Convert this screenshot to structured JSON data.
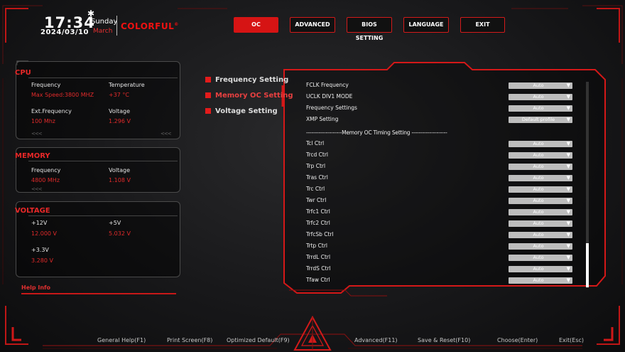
{
  "header": {
    "time": "17:34",
    "day": "Sunday",
    "date": "2024/03/10",
    "month": "March",
    "brand": "COLORFUL",
    "brand_mark": "®"
  },
  "tabs": [
    {
      "label": "OC",
      "active": true
    },
    {
      "label": "ADVANCED",
      "active": false
    },
    {
      "label": "BIOS SETTING",
      "active": false
    },
    {
      "label": "LANGUAGE",
      "active": false
    },
    {
      "label": "EXIT",
      "active": false
    }
  ],
  "cpu": {
    "title": "CPU",
    "frequency_label": "Frequency",
    "frequency_value": "Max Speed:3800 MHZ",
    "temperature_label": "Temperature",
    "temperature_value": "+37 °C",
    "ext_label": "Ext.Frequency",
    "ext_value": "100 Mhz",
    "voltage_label": "Voltage",
    "voltage_value": "1.296 V"
  },
  "memory": {
    "title": "MEMORY",
    "frequency_label": "Frequency",
    "frequency_value": "4800 MHz",
    "voltage_label": "Voltage",
    "voltage_value": "1.108 V"
  },
  "voltage": {
    "title": "VOLTAGE",
    "v12_label": "+12V",
    "v12_value": "12.000 V",
    "v5_label": "+5V",
    "v5_value": "5.032 V",
    "v33_label": "+3.3V",
    "v33_value": "3.280 V"
  },
  "chevrons": "<<<",
  "help_info": "Help Info",
  "submenu": [
    {
      "label": "Frequency Setting",
      "active": false
    },
    {
      "label": "Memory OC Setting",
      "active": true
    },
    {
      "label": "Voltage Setting",
      "active": false
    }
  ],
  "settings_top": [
    {
      "label": "FCLK Frequency",
      "value": "Auto"
    },
    {
      "label": "UCLK DIV1 MODE",
      "value": "Auto"
    },
    {
      "label": "Frequency Settings",
      "value": "Auto"
    },
    {
      "label": "XMP Setting",
      "value": "Default profile"
    }
  ],
  "timing_divider": "--------------------Memory OC Timing Setting --------------------",
  "settings_timing": [
    {
      "label": "Tcl Ctrl",
      "value": "Auto"
    },
    {
      "label": "Trcd Ctrl",
      "value": "Auto"
    },
    {
      "label": "Trp Ctrl",
      "value": "Auto"
    },
    {
      "label": "Tras Ctrl",
      "value": "Auto"
    },
    {
      "label": "Trc Ctrl",
      "value": "Auto"
    },
    {
      "label": "Twr Ctrl",
      "value": "Auto"
    },
    {
      "label": "Trfc1 Ctrl",
      "value": "Auto"
    },
    {
      "label": "Trfc2 Ctrl",
      "value": "Auto"
    },
    {
      "label": "TrfcSb Ctrl",
      "value": "Auto"
    },
    {
      "label": "Trtp Ctrl",
      "value": "Auto"
    },
    {
      "label": "TrrdL Ctrl",
      "value": "Auto"
    },
    {
      "label": "TrrdS Ctrl",
      "value": "Auto"
    },
    {
      "label": "Tfaw Ctrl",
      "value": "Auto"
    }
  ],
  "dropdown_arrow": "▼",
  "footer": [
    "General Help(F1)",
    "Print Screen(F8)",
    "Optimized Default(F9)",
    "Advanced(F11)",
    "Save & Reset(F10)",
    "Choose(Enter)",
    "Exit(Esc)"
  ],
  "colors": {
    "accent": "#e01818",
    "background": "#1a1a1c",
    "select_box": "#bdbdbd"
  }
}
